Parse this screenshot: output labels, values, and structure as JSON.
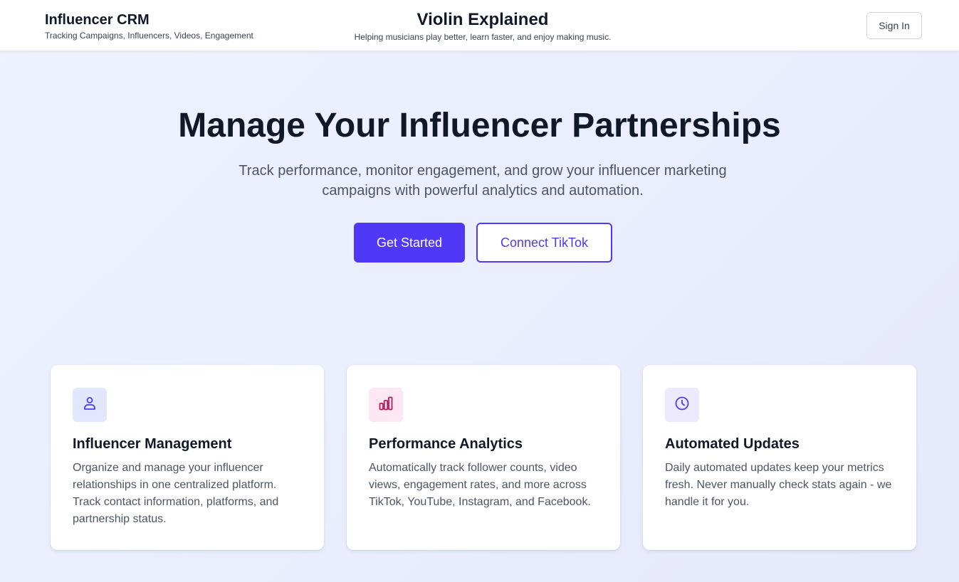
{
  "header": {
    "app_title": "Influencer CRM",
    "app_subtitle": "Tracking Campaigns, Influencers, Videos, Engagement",
    "site_title": "Violin Explained",
    "site_tagline": "Helping musicians play better, learn faster, and enjoy making music.",
    "sign_in_label": "Sign In"
  },
  "hero": {
    "title": "Manage Your Influencer Partnerships",
    "subtitle": "Track performance, monitor engagement, and grow your influencer marketing campaigns with powerful analytics and automation.",
    "primary_cta": "Get Started",
    "secondary_cta": "Connect TikTok"
  },
  "features": [
    {
      "icon": "user-icon",
      "title": "Influencer Management",
      "description": "Organize and manage your influencer relationships in one centralized platform. Track contact information, platforms, and partnership status."
    },
    {
      "icon": "bar-chart-icon",
      "title": "Performance Analytics",
      "description": "Automatically track follower counts, video views, engagement rates, and more across TikTok, YouTube, Instagram, and Facebook."
    },
    {
      "icon": "clock-icon",
      "title": "Automated Updates",
      "description": "Daily automated updates keep your metrics fresh. Never manually check stats again - we handle it for you."
    }
  ],
  "colors": {
    "accent": "#4f39f6",
    "feature_1_bg": "#e0e7ff",
    "feature_1_icon": "#4f39f6",
    "feature_2_bg": "#fce7f3",
    "feature_2_icon": "#be185d",
    "feature_3_bg": "#ede9fe",
    "feature_3_icon": "#4f39f6"
  }
}
